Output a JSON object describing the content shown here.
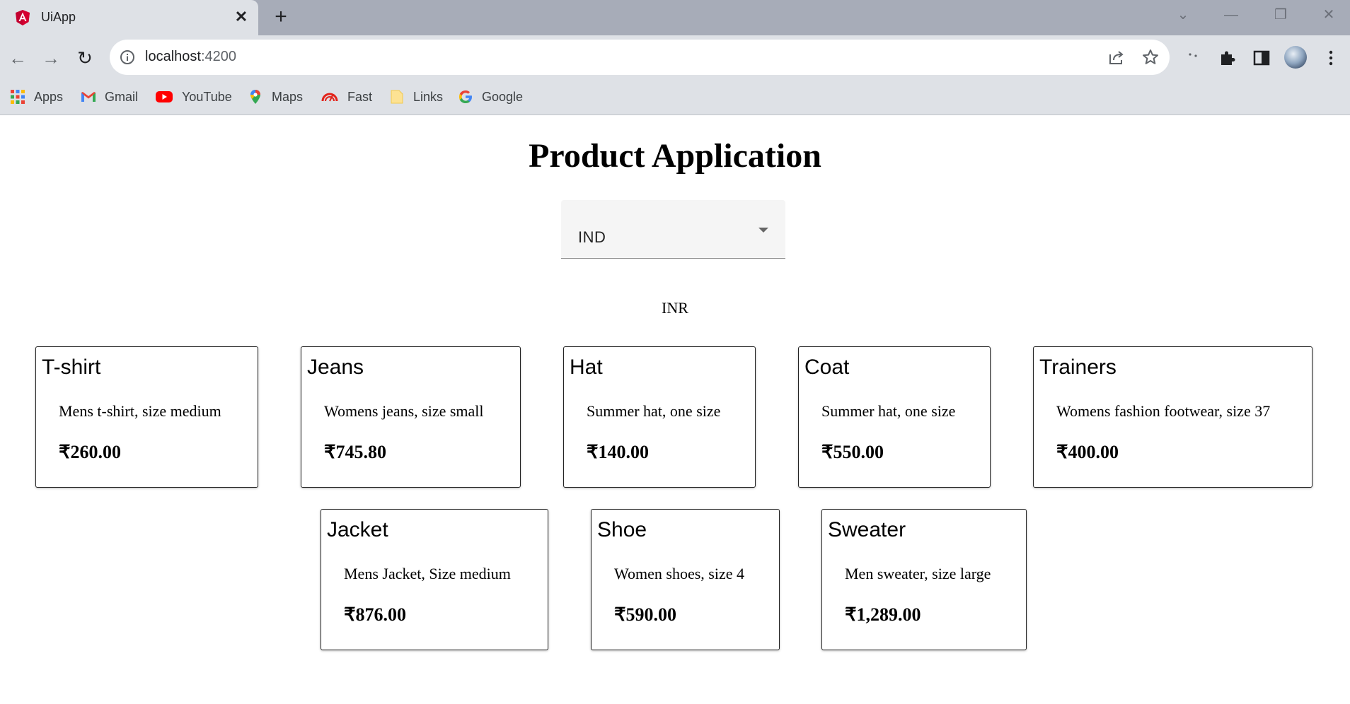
{
  "browser": {
    "tab_title": "UiApp",
    "tab_close": "✕",
    "new_tab": "+",
    "url_host": "localhost",
    "url_port": ":4200",
    "window_controls": {
      "chevron": "⌄",
      "minimize": "—",
      "restore": "❐",
      "close": "✕"
    },
    "nav": {
      "back": "←",
      "forward": "→",
      "reload": "↻"
    },
    "bookmarks": [
      {
        "label": "Apps",
        "icon": "apps-grid-icon"
      },
      {
        "label": "Gmail",
        "icon": "gmail-icon"
      },
      {
        "label": "YouTube",
        "icon": "youtube-icon"
      },
      {
        "label": "Maps",
        "icon": "maps-pin-icon"
      },
      {
        "label": "Fast",
        "icon": "speedometer-icon"
      },
      {
        "label": "Links",
        "icon": "folder-icon"
      },
      {
        "label": "Google",
        "icon": "google-icon"
      }
    ]
  },
  "app": {
    "title": "Product Application",
    "country_select": {
      "value": "IND"
    },
    "currency": "INR",
    "products": [
      {
        "name": "T-shirt",
        "description": "Mens t-shirt, size medium",
        "price": "₹260.00"
      },
      {
        "name": "Jeans",
        "description": "Womens jeans, size small",
        "price": "₹745.80"
      },
      {
        "name": "Hat",
        "description": "Summer hat, one size",
        "price": "₹140.00"
      },
      {
        "name": "Coat",
        "description": "Summer hat, one size",
        "price": "₹550.00"
      },
      {
        "name": "Trainers",
        "description": "Womens fashion footwear, size 37",
        "price": "₹400.00"
      },
      {
        "name": "Jacket",
        "description": "Mens Jacket, Size medium",
        "price": "₹876.00"
      },
      {
        "name": "Shoe",
        "description": "Women shoes, size 4",
        "price": "₹590.00"
      },
      {
        "name": "Sweater",
        "description": "Men sweater, size large",
        "price": "₹1,289.00"
      }
    ]
  }
}
